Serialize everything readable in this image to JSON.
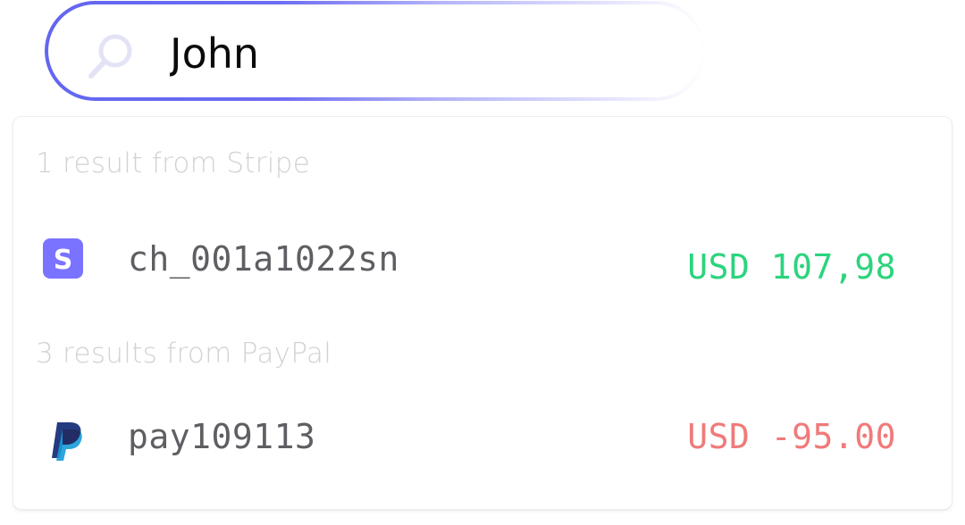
{
  "search": {
    "value": "John",
    "icon": "search-icon"
  },
  "groups": [
    {
      "heading": "1 result from Stripe",
      "items": [
        {
          "icon": "stripe-icon",
          "id": "ch_001a1022sn",
          "amount": "USD 107,98",
          "amount_color": "#2bd47d"
        }
      ]
    },
    {
      "heading": "3 results from PayPal",
      "items": [
        {
          "icon": "paypal-icon",
          "id": "pay109113",
          "amount": "USD -95.00",
          "amount_color": "#f07a7a"
        }
      ]
    }
  ],
  "colors": {
    "accent": "#6366f1",
    "stripe": "#7a73ff",
    "paypal_dark": "#253b80",
    "paypal_light": "#179bd7"
  }
}
